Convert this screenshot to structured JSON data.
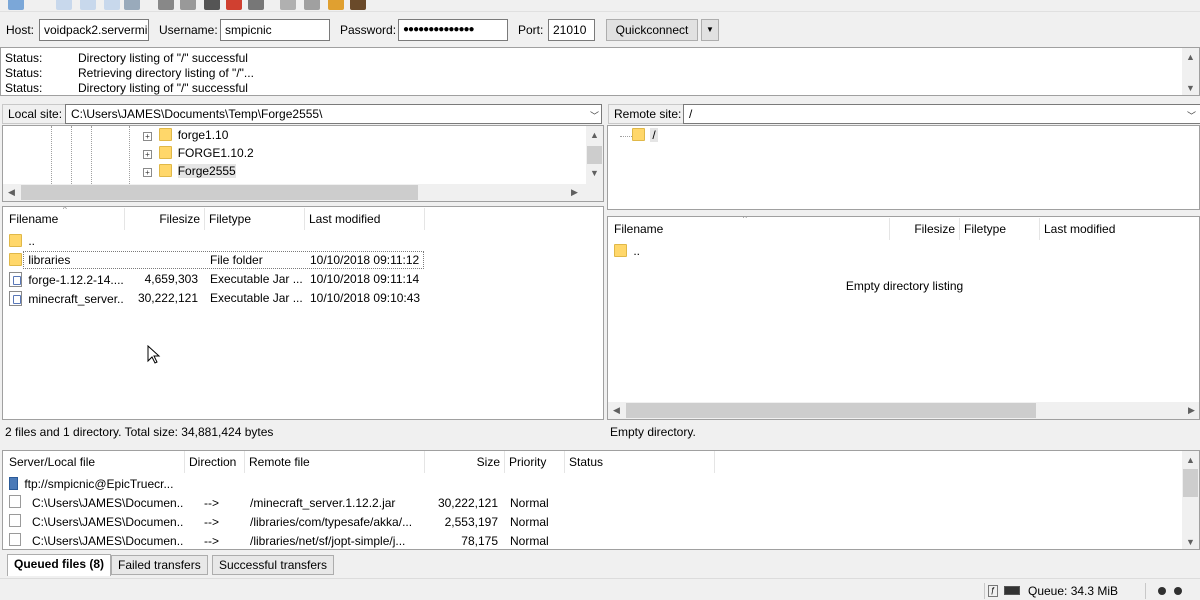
{
  "quickconnect": {
    "host_label": "Host:",
    "host_value": "voidpack2.servermi",
    "username_label": "Username:",
    "username_value": "smpicnic",
    "password_label": "Password:",
    "password_value": "●●●●●●●●●●●●●●",
    "port_label": "Port:",
    "port_value": "21010",
    "button_label": "Quickconnect",
    "dropdown_glyph": "▼"
  },
  "log": [
    {
      "key": "Status:",
      "msg": "Directory listing of \"/\" successful"
    },
    {
      "key": "Status:",
      "msg": "Retrieving directory listing of \"/\"..."
    },
    {
      "key": "Status:",
      "msg": "Directory listing of \"/\" successful"
    }
  ],
  "local": {
    "site_label": "Local site:",
    "path": "C:\\Users\\JAMES\\Documents\\Temp\\Forge2555\\",
    "tree": [
      "forge1.10",
      "FORGE1.10.2",
      "Forge2555"
    ],
    "headers": {
      "filename": "Filename",
      "filesize": "Filesize",
      "filetype": "Filetype",
      "modified": "Last modified"
    },
    "files": [
      {
        "name": "..",
        "size": "",
        "type": "",
        "modified": "",
        "icon": "folder"
      },
      {
        "name": "libraries",
        "size": "",
        "type": "File folder",
        "modified": "10/10/2018 09:11:12",
        "icon": "folder"
      },
      {
        "name": "forge-1.12.2-14....",
        "size": "4,659,303",
        "type": "Executable Jar ...",
        "modified": "10/10/2018 09:11:14",
        "icon": "jar"
      },
      {
        "name": "minecraft_server....",
        "size": "30,222,121",
        "type": "Executable Jar ...",
        "modified": "10/10/2018 09:10:43",
        "icon": "jar"
      }
    ],
    "status": "2 files and 1 directory. Total size: 34,881,424 bytes"
  },
  "remote": {
    "site_label": "Remote site:",
    "path": "/",
    "tree_root": "/",
    "headers": {
      "filename": "Filename",
      "filesize": "Filesize",
      "filetype": "Filetype",
      "modified": "Last modified"
    },
    "parent_entry": "..",
    "empty_message": "Empty directory listing",
    "status": "Empty directory."
  },
  "queue": {
    "headers": {
      "server": "Server/Local file",
      "direction": "Direction",
      "remote": "Remote file",
      "size": "Size",
      "priority": "Priority",
      "status": "Status"
    },
    "server": "ftp://smpicnic@EpicTruecr...",
    "rows": [
      {
        "local": "C:\\Users\\JAMES\\Documen...",
        "direction": "-->",
        "remote": "/minecraft_server.1.12.2.jar",
        "size": "30,222,121",
        "priority": "Normal"
      },
      {
        "local": "C:\\Users\\JAMES\\Documen...",
        "direction": "-->",
        "remote": "/libraries/com/typesafe/akka/...",
        "size": "2,553,197",
        "priority": "Normal"
      },
      {
        "local": "C:\\Users\\JAMES\\Documen...",
        "direction": "-->",
        "remote": "/libraries/net/sf/jopt-simple/j...",
        "size": "78,175",
        "priority": "Normal"
      }
    ]
  },
  "tabs": {
    "queued": "Queued files (8)",
    "failed": "Failed transfers",
    "successful": "Successful transfers"
  },
  "statusbar": {
    "queue": "Queue: 34.3 MiB"
  },
  "colors": {
    "folder": "#ffd76a",
    "selection_border": "#7a7a7a",
    "scroll_thumb": "#cdcdcd"
  }
}
